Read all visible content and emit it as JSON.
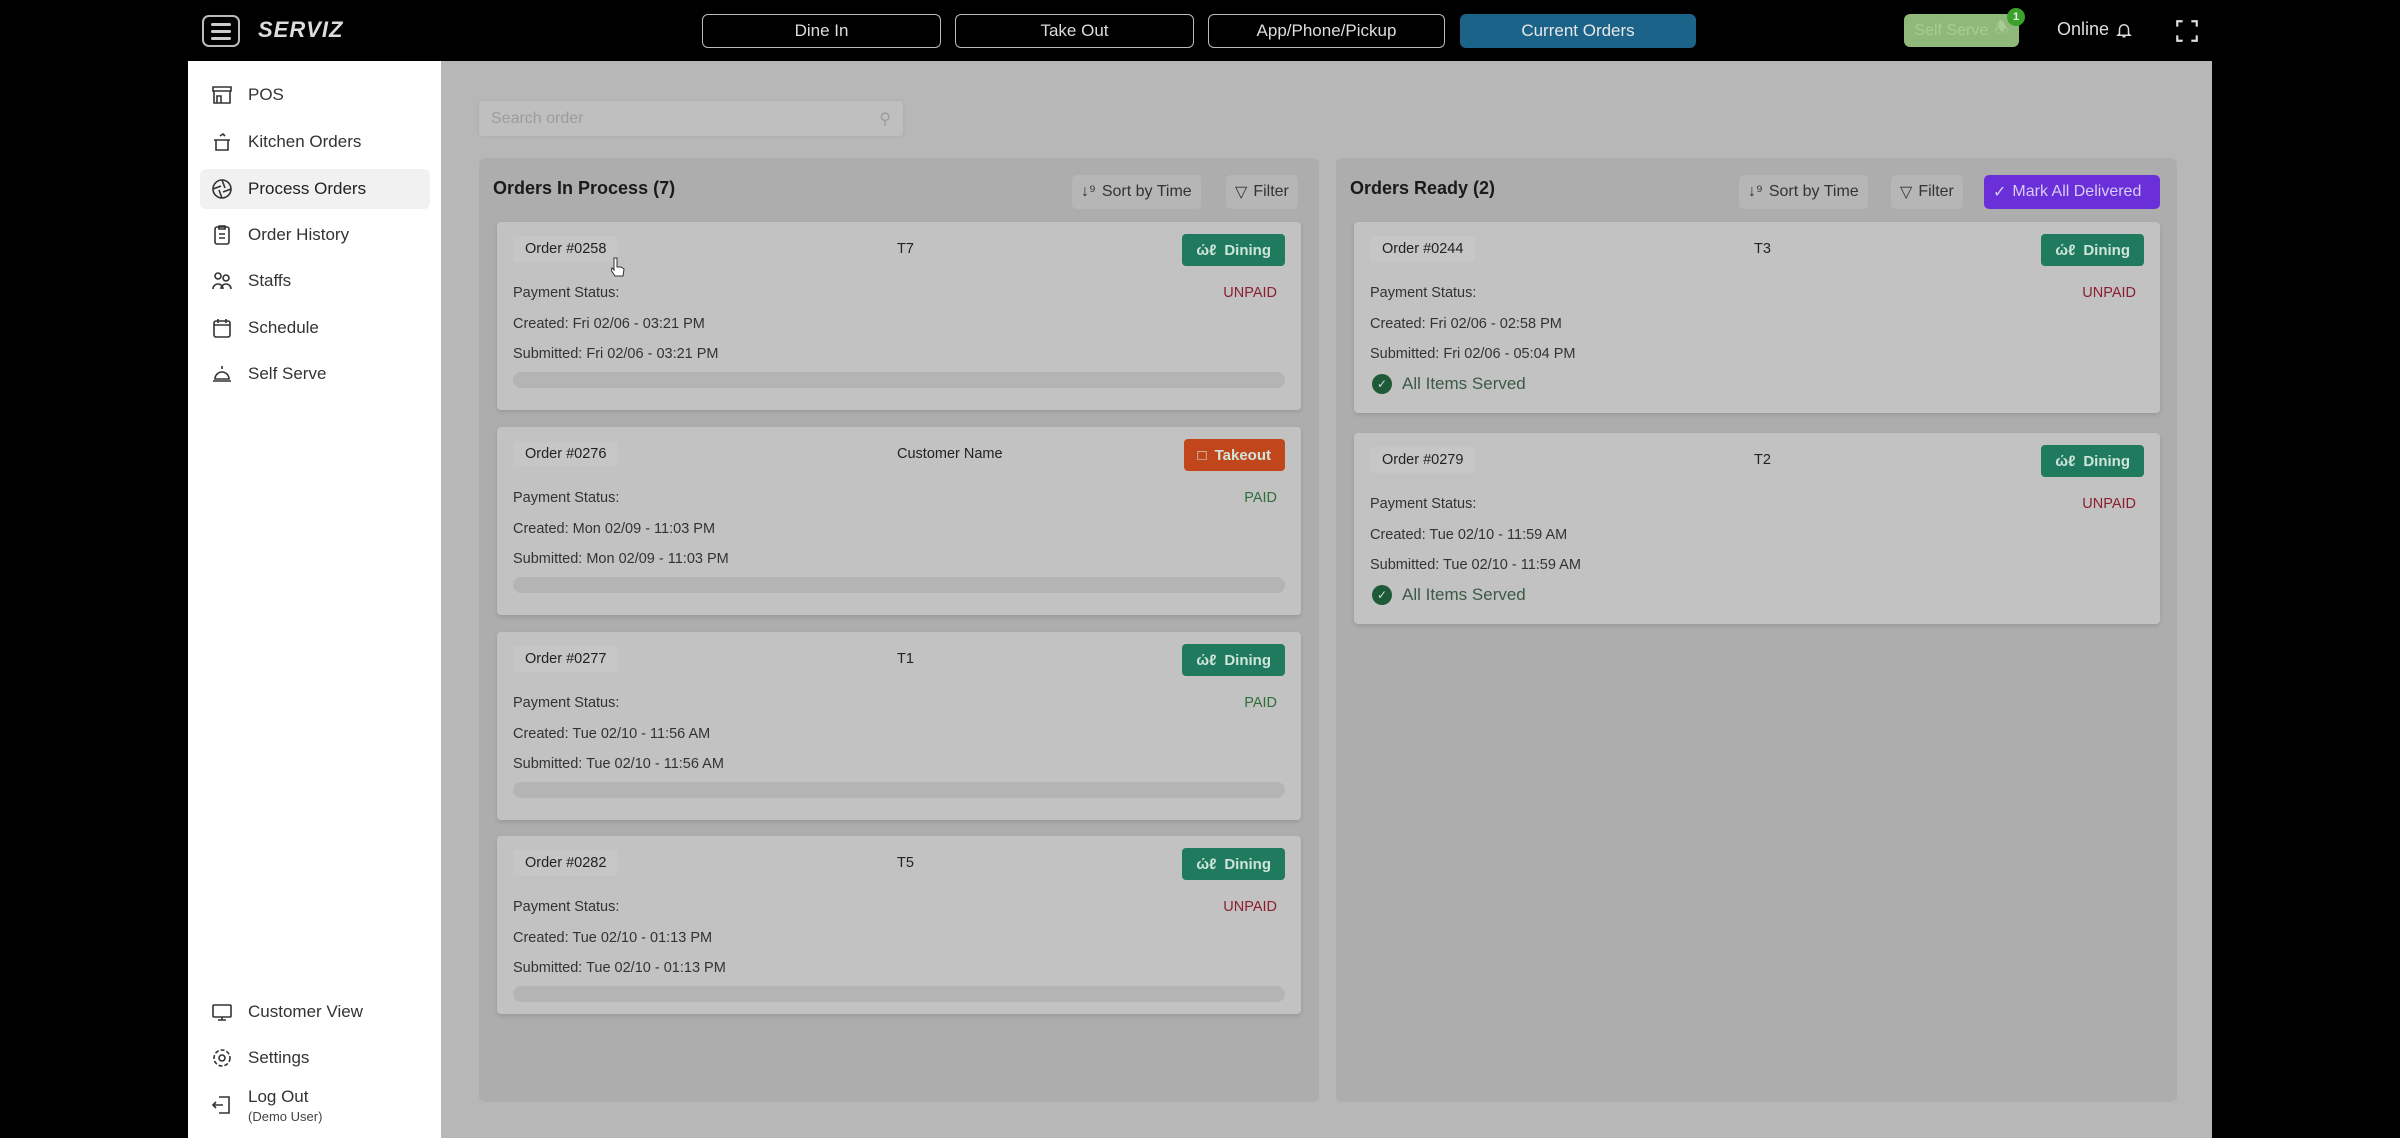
{
  "app": {
    "brand": "SERVIZ"
  },
  "nav": {
    "tabs": [
      {
        "label": "Dine In"
      },
      {
        "label": "Take Out"
      },
      {
        "label": "App/Phone/Pickup"
      },
      {
        "label": "Current Orders",
        "active": true
      }
    ],
    "self_serve_label": "Self Serve",
    "self_serve_badge": "1",
    "status": "Online"
  },
  "sidebar": {
    "items": [
      {
        "label": "POS",
        "icon": "store-icon"
      },
      {
        "label": "Kitchen Orders",
        "icon": "pot-icon"
      },
      {
        "label": "Process Orders",
        "icon": "aperture-icon",
        "active": true
      },
      {
        "label": "Order History",
        "icon": "clipboard-icon"
      },
      {
        "label": "Staffs",
        "icon": "users-icon"
      },
      {
        "label": "Schedule",
        "icon": "calendar-icon"
      },
      {
        "label": "Self Serve",
        "icon": "bell-icon"
      }
    ],
    "bottom": {
      "customer_view": "Customer View",
      "settings": "Settings",
      "logout": "Log Out",
      "user": "(Demo User)"
    }
  },
  "search": {
    "placeholder": "Search order"
  },
  "in_process": {
    "title": "Orders In Process (7)",
    "sort": "Sort by Time",
    "filter": "Filter",
    "orders": [
      {
        "id": "Order #0258",
        "table": "T7",
        "type": "Dining",
        "payment_label": "Payment Status:",
        "payment": "UNPAID",
        "created": "Created: Fri 02/06 - 03:21 PM",
        "submitted": "Submitted: Fri 02/06 - 03:21 PM"
      },
      {
        "id": "Order #0276",
        "table": "Customer Name",
        "type": "Takeout",
        "payment_label": "Payment Status:",
        "payment": "PAID",
        "created": "Created: Mon 02/09 - 11:03 PM",
        "submitted": "Submitted: Mon 02/09 - 11:03 PM"
      },
      {
        "id": "Order #0277",
        "table": "T1",
        "type": "Dining",
        "payment_label": "Payment Status:",
        "payment": "PAID",
        "created": "Created: Tue 02/10 - 11:56 AM",
        "submitted": "Submitted: Tue 02/10 - 11:56 AM"
      },
      {
        "id": "Order #0282",
        "table": "T5",
        "type": "Dining",
        "payment_label": "Payment Status:",
        "payment": "UNPAID",
        "created": "Created: Tue 02/10 - 01:13 PM",
        "submitted": "Submitted: Tue 02/10 - 01:13 PM"
      }
    ]
  },
  "ready": {
    "title": "Orders Ready (2)",
    "sort": "Sort by Time",
    "filter": "Filter",
    "mark_all": "Mark All Delivered",
    "orders": [
      {
        "id": "Order #0244",
        "table": "T3",
        "type": "Dining",
        "payment_label": "Payment Status:",
        "payment": "UNPAID",
        "created": "Created: Fri 02/06 - 02:58 PM",
        "submitted": "Submitted: Fri 02/06 - 05:04 PM",
        "served": "All Items Served"
      },
      {
        "id": "Order #0279",
        "table": "T2",
        "type": "Dining",
        "payment_label": "Payment Status:",
        "payment": "UNPAID",
        "created": "Created: Tue 02/10 - 11:59 AM",
        "submitted": "Submitted: Tue 02/10 - 11:59 AM",
        "served": "All Items Served"
      }
    ]
  },
  "colors": {
    "dining": "#1f7a5e",
    "takeout": "#c2461c",
    "mark_all": "#6a2fd9",
    "unpaid": "#8b1f2f",
    "paid": "#2f6f3a",
    "active_tab": "#1b6389"
  }
}
